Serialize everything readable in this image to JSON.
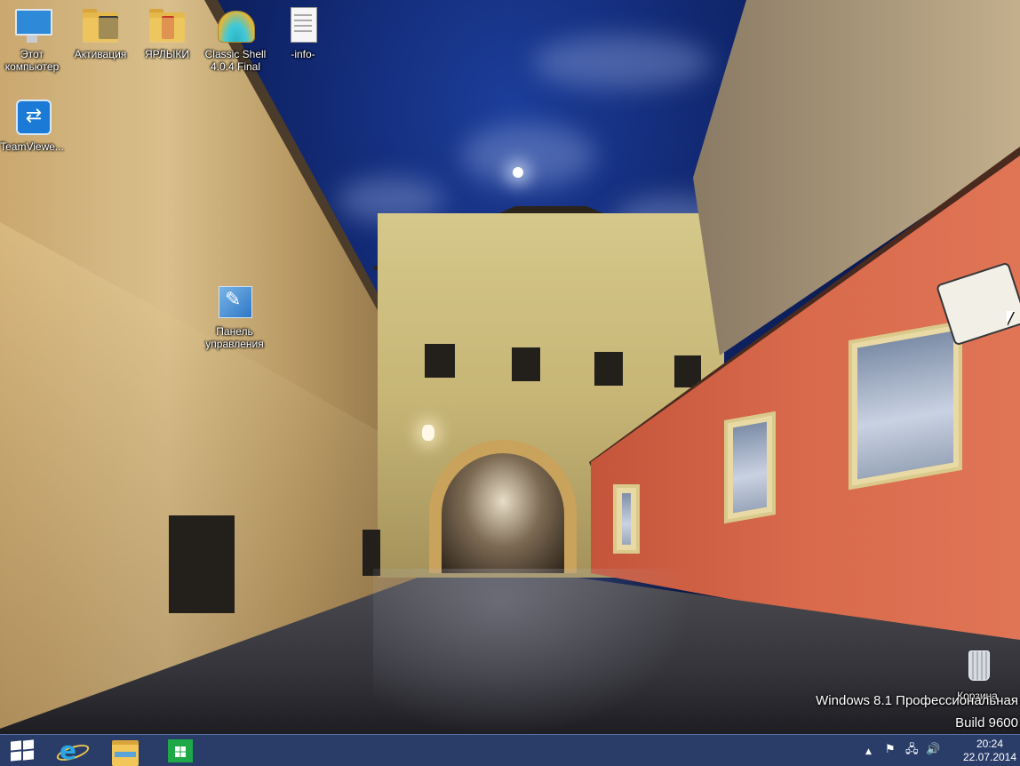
{
  "desktop": {
    "icons": [
      {
        "label": "Этот компьютер",
        "icon": "computer-icon"
      },
      {
        "label": "Активация",
        "icon": "folder-icon"
      },
      {
        "label": "ЯРЛЫКИ",
        "icon": "folder-icon"
      },
      {
        "label": "Classic Shell 4.0.4 Final",
        "icon": "classic-shell-icon"
      },
      {
        "label": "-info-",
        "icon": "text-document-icon"
      },
      {
        "label": "TeamViewe...",
        "icon": "teamviewer-icon"
      },
      {
        "label": "Панель управления",
        "icon": "control-panel-icon"
      },
      {
        "label": "Корзина",
        "icon": "recycle-bin-icon"
      }
    ]
  },
  "watermark": {
    "line1": "Windows 8.1 Профессиональная",
    "line2": "Build 9600"
  },
  "taskbar": {
    "pinned": [
      {
        "name": "start",
        "icon": "windows-start-icon"
      },
      {
        "name": "internet-explorer",
        "icon": "internet-explorer-icon"
      },
      {
        "name": "file-explorer",
        "icon": "file-explorer-icon"
      },
      {
        "name": "store",
        "icon": "windows-store-icon"
      }
    ],
    "tray": {
      "icons": [
        "show-hidden-icons-arrow-icon",
        "action-center-flag-icon",
        "network-icon",
        "volume-icon"
      ],
      "arrow_glyph": "▲",
      "flag_glyph": "⚑",
      "network_glyph": "🖧",
      "volume_glyph": "🔊"
    },
    "clock": {
      "time": "20:24",
      "date": "22.07.2014"
    }
  },
  "colors": {
    "taskbar": "#182c5c",
    "sky": "#0f2468",
    "ie_blue": "#2aa6e3",
    "store_green": "#1ea847"
  }
}
